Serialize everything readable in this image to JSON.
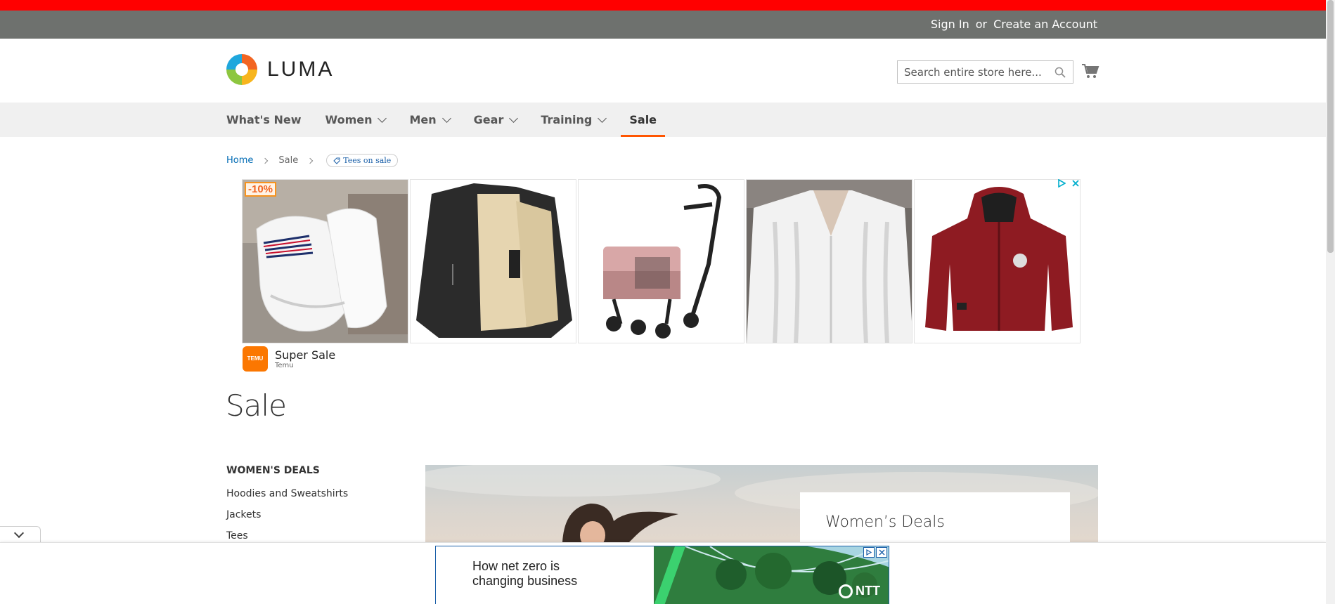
{
  "panel": {
    "sign_in": "Sign In",
    "or": "or",
    "create_account": "Create an Account"
  },
  "logo": {
    "text": "LUMA"
  },
  "search": {
    "placeholder": "Search entire store here..."
  },
  "nav": {
    "items": [
      {
        "label": "What's New",
        "has_menu": false
      },
      {
        "label": "Women",
        "has_menu": true
      },
      {
        "label": "Men",
        "has_menu": true
      },
      {
        "label": "Gear",
        "has_menu": true
      },
      {
        "label": "Training",
        "has_menu": true
      },
      {
        "label": "Sale",
        "has_menu": false,
        "active": true
      }
    ],
    "active_color": "#ff5501"
  },
  "breadcrumb": {
    "home": "Home",
    "current": "Sale",
    "tag": "Tees on sale"
  },
  "ad": {
    "discount_badge": "-10%",
    "advertiser_title": "Super Sale",
    "advertiser_name": "Temu",
    "logo_text": "TEMU",
    "products": [
      "white sneakers",
      "black fleece jacket",
      "pet stroller",
      "white cable knit cardigan",
      "red hooded jacket"
    ]
  },
  "page": {
    "title": "Sale"
  },
  "sidebar": {
    "heading": "WOMEN'S DEALS",
    "items": [
      "Hoodies and Sweatshirts",
      "Jackets",
      "Tees"
    ]
  },
  "hero": {
    "card_title": "Women’s Deals"
  },
  "bottom_ad": {
    "line1": "How net zero is",
    "line2": "changing business",
    "brand": "NTT"
  },
  "colors": {
    "header_panel": "#6e716e",
    "top_strip": "#ff0000",
    "link": "#006bb4",
    "accent": "#ff5501"
  }
}
